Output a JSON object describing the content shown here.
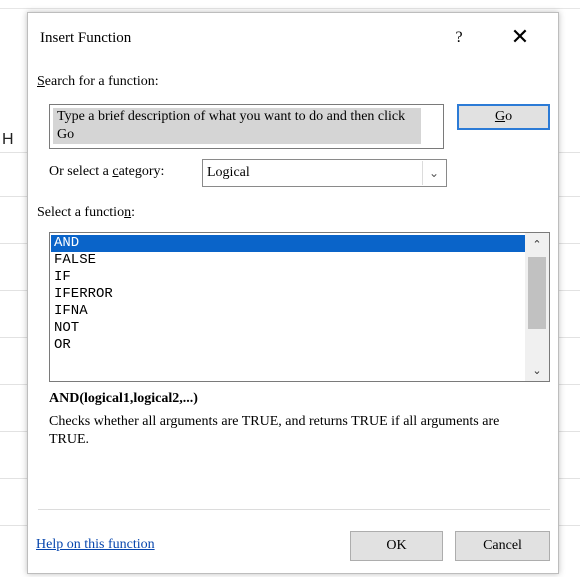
{
  "dialog": {
    "title": "Insert Function",
    "help_glyph": "?",
    "close_glyph": "✕"
  },
  "background": {
    "partial_column_letter": "H"
  },
  "search": {
    "label_prefix": "",
    "label_accel": "S",
    "label_rest": "earch for a function:",
    "value": "Type a brief description of what you want to do and then click Go",
    "go_accel": "G",
    "go_rest": "o"
  },
  "category": {
    "label_prefix": "Or select a ",
    "label_accel": "c",
    "label_rest": "ategory:",
    "selected": "Logical"
  },
  "function_list": {
    "label_prefix": "Select a functio",
    "label_accel": "n",
    "label_rest": ":",
    "items": [
      "AND",
      "FALSE",
      "IF",
      "IFERROR",
      "IFNA",
      "NOT",
      "OR"
    ],
    "selected_index": 0,
    "scroll_up_glyph": "⌃",
    "scroll_down_glyph": "⌄"
  },
  "details": {
    "signature": "AND(logical1,logical2,...)",
    "description": "Checks whether all arguments are TRUE, and returns TRUE if all arguments are TRUE."
  },
  "footer": {
    "help_link": "Help on this function",
    "ok_label": "OK",
    "cancel_label": "Cancel"
  },
  "colors": {
    "selection": "#0a64c9",
    "go_border": "#2c7bd6",
    "link": "#0645ad"
  }
}
